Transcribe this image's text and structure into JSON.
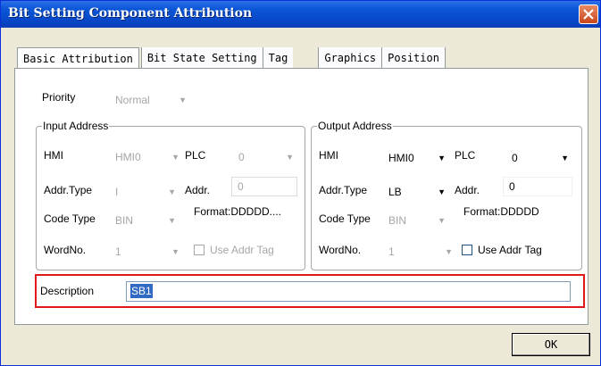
{
  "window": {
    "title": "Bit Setting Component Attribution"
  },
  "tabs": [
    {
      "label": "Basic Attribution"
    },
    {
      "label": "Bit State Setting"
    },
    {
      "label": "Tag"
    },
    {
      "label": "Graphics"
    },
    {
      "label": "Position"
    }
  ],
  "priority": {
    "label": "Priority",
    "value": "Normal"
  },
  "input_address": {
    "title": "Input Address",
    "hmi_label": "HMI",
    "hmi_value": "HMI0",
    "plc_label": "PLC",
    "plc_value": "0",
    "addr_type_label": "Addr.Type",
    "addr_type_value": "I",
    "addr_label": "Addr.",
    "addr_value": "0",
    "code_type_label": "Code Type",
    "code_type_value": "BIN",
    "format_text": "Format:DDDDD....",
    "word_no_label": "WordNo.",
    "word_no_value": "1",
    "use_addr_tag_label": "Use Addr Tag"
  },
  "output_address": {
    "title": "Output Address",
    "hmi_label": "HMI",
    "hmi_value": "HMI0",
    "plc_label": "PLC",
    "plc_value": "0",
    "addr_type_label": "Addr.Type",
    "addr_type_value": "LB",
    "addr_label": "Addr.",
    "addr_value": "0",
    "code_type_label": "Code Type",
    "code_type_value": "BIN",
    "format_text": "Format:DDDDD",
    "word_no_label": "WordNo.",
    "word_no_value": "1",
    "use_addr_tag_label": "Use Addr Tag"
  },
  "description": {
    "label": "Description",
    "value": "SB1"
  },
  "buttons": {
    "ok": "OK"
  },
  "colors": {
    "titlebar": "#0a57d8",
    "highlight": "#e01818",
    "selection": "#316ac5"
  }
}
